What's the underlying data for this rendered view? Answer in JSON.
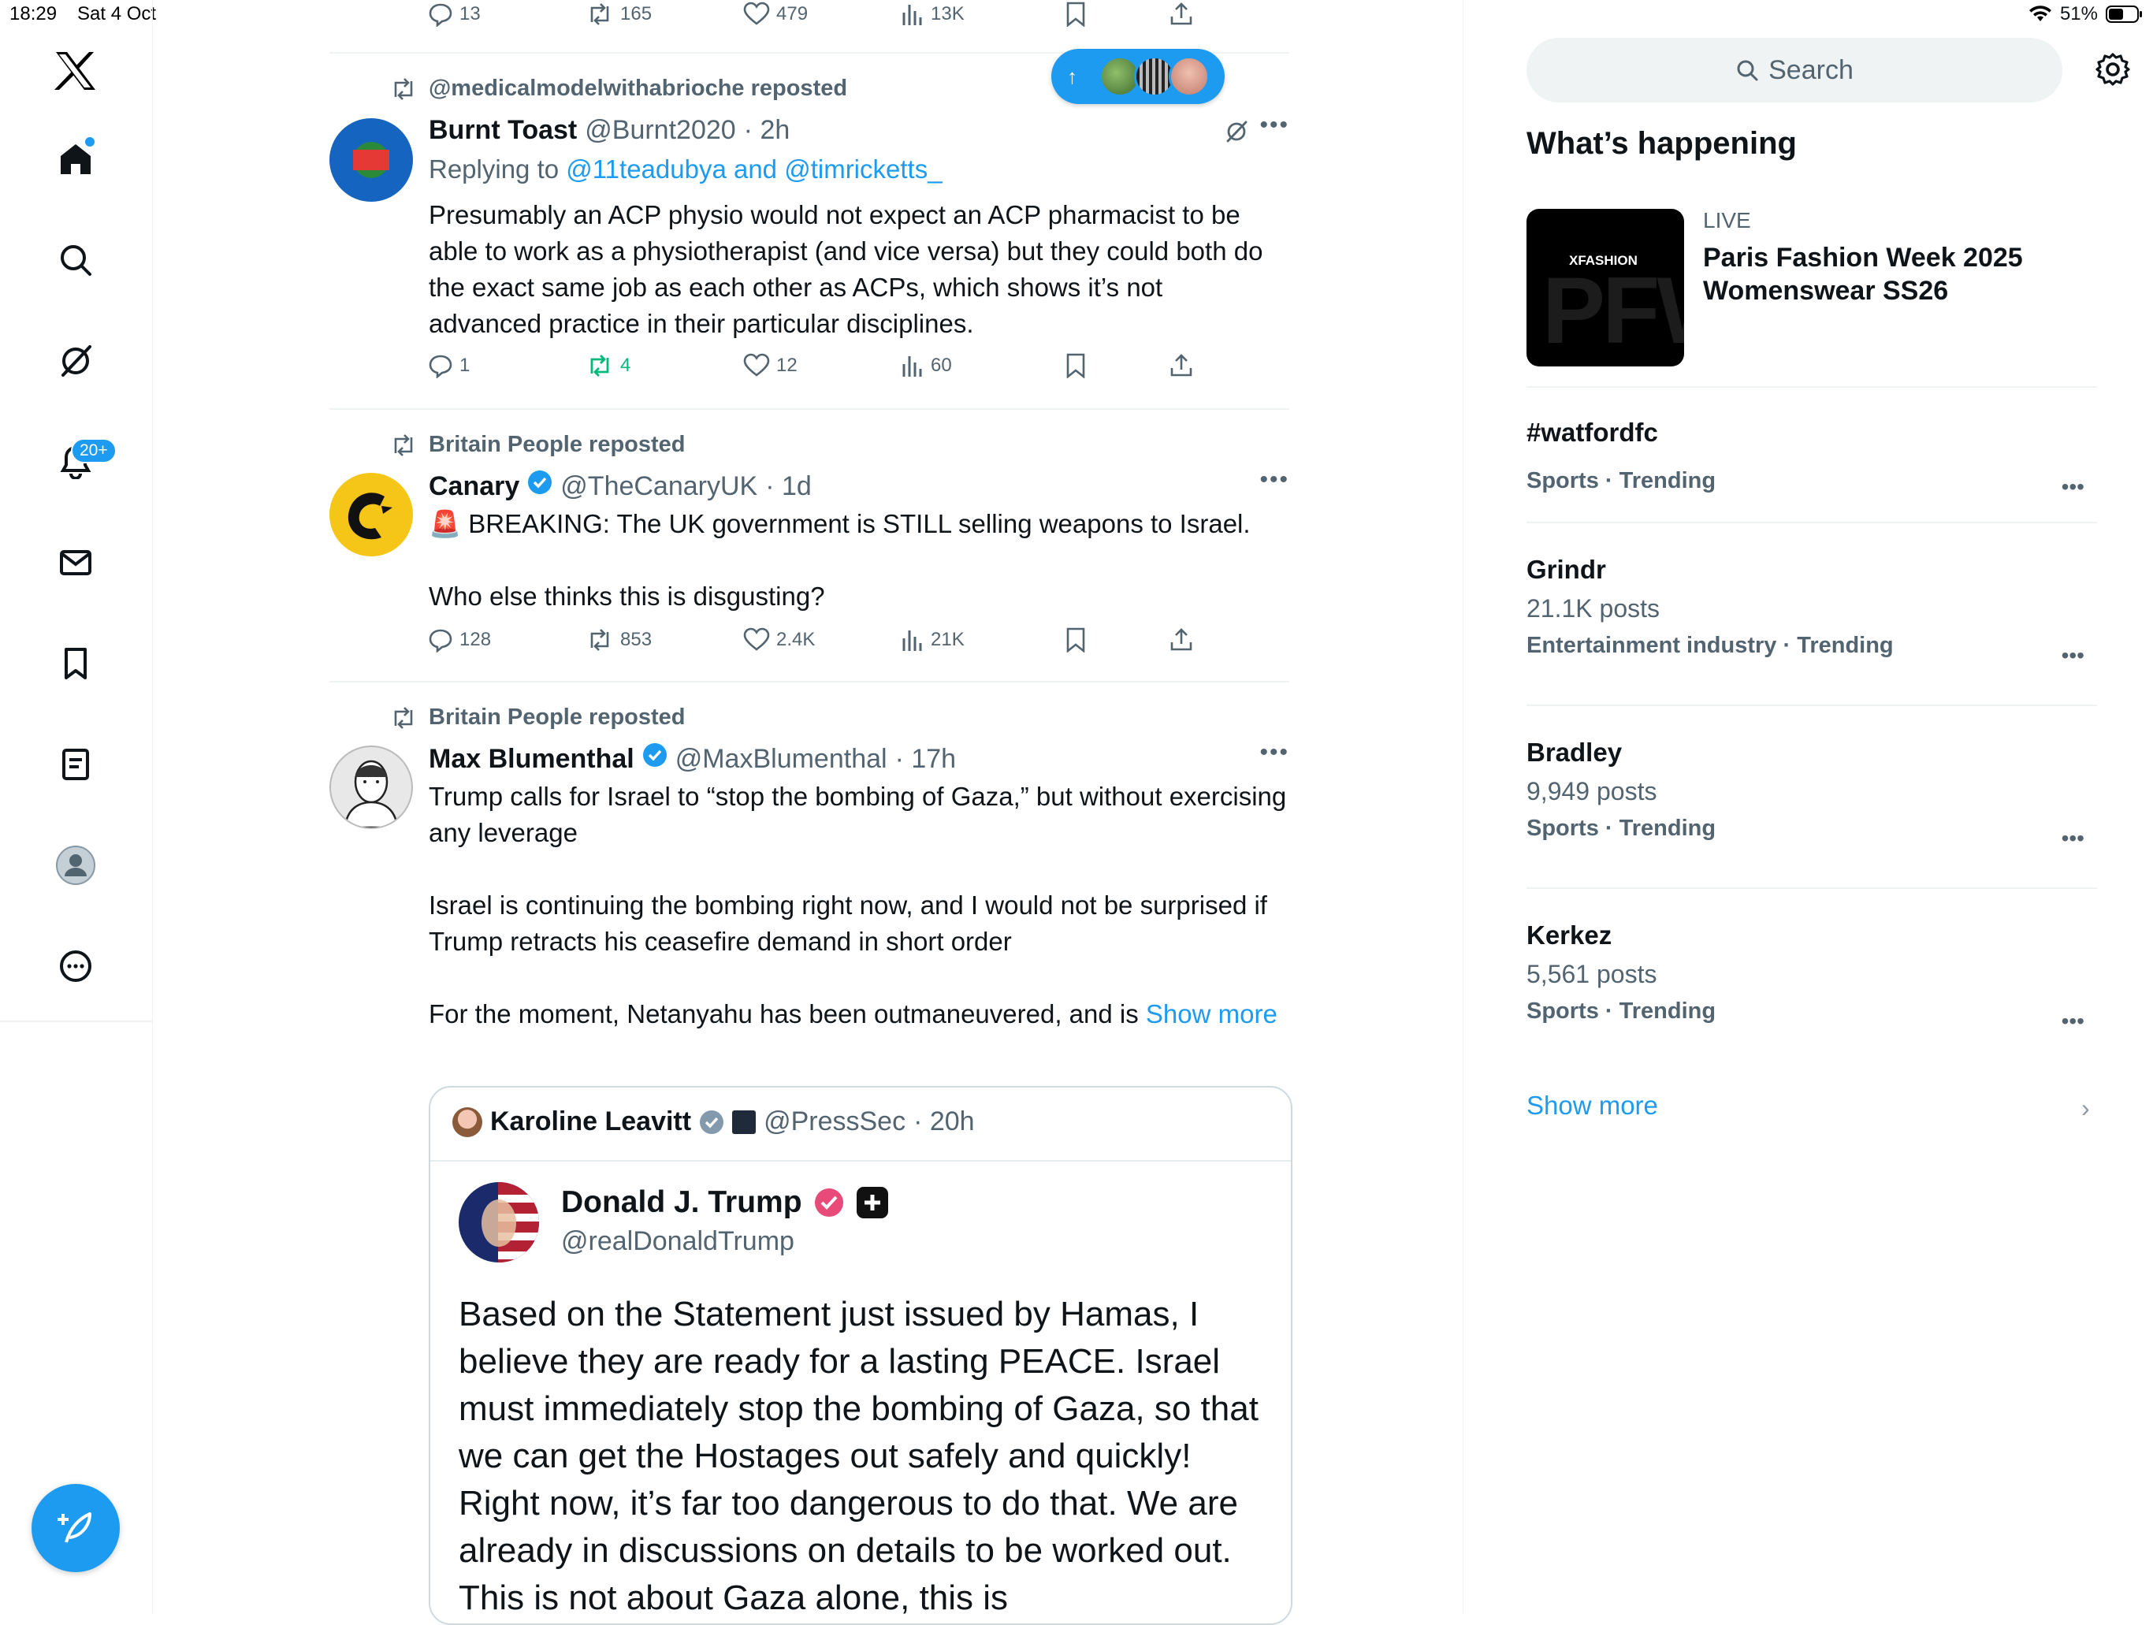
{
  "status_bar": {
    "time": "18:29",
    "date": "Sat 4 Oct",
    "battery": "51%"
  },
  "nav": {
    "notifications_badge": "20+"
  },
  "new_posts_pill": {
    "arrow": "↑"
  },
  "top_actions": {
    "replies": "13",
    "reposts": "165",
    "likes": "479",
    "views": "13K"
  },
  "posts": [
    {
      "repost_label": "@medicalmodelwithabrioche reposted",
      "name": "Burnt Toast",
      "handle": "@Burnt2020",
      "time": "· 2h",
      "replying_prefix": "Replying to ",
      "replying_to": "@11teadubya and @timricketts_",
      "text": "Presumably an ACP physio would not expect an ACP pharmacist to be able to work as a physiotherapist (and vice versa) but they could both do the exact same job as each other as ACPs, which shows it’s not advanced practice in their particular disciplines.",
      "replies": "1",
      "reposts": "4",
      "likes": "12",
      "views": "60"
    },
    {
      "repost_label": "Britain People reposted",
      "name": "Canary",
      "handle": "@TheCanaryUK",
      "time": "· 1d",
      "text_line1": "🚨 BREAKING: The UK government is STILL selling weapons to Israel.",
      "text_line2": "Who else thinks this is disgusting?",
      "replies": "128",
      "reposts": "853",
      "likes": "2.4K",
      "views": "21K"
    },
    {
      "repost_label": "Britain People reposted",
      "name": "Max Blumenthal",
      "handle": "@MaxBlumenthal",
      "time": "· 17h",
      "para1": "Trump calls for Israel to “stop the bombing of Gaza,” but without exercising any leverage",
      "para2": "Israel is continuing the bombing right now, and I would not be surprised if Trump retracts his ceasefire demand in short order",
      "para3": "For the moment, Netanyahu has been outmaneuvered, and is ",
      "show_more": "Show more",
      "quote": {
        "name": "Karoline Leavitt",
        "handle": "@PressSec",
        "time": "· 20h",
        "inner_name": "Donald J. Trump",
        "inner_handle": "@realDonaldTrump",
        "inner_text": "Based on the Statement just issued by Hamas, I believe they are ready for a lasting PEACE. Israel must immediately stop the bombing of Gaza, so that we can get the Hostages out safely and quickly! Right now, it’s far too dangerous to do that. We are already in discussions on details to be worked out. This is not about Gaza alone, this is"
      }
    }
  ],
  "sidebar": {
    "search_placeholder": "Search",
    "heading": "What’s happening",
    "featured": {
      "badge": "LIVE",
      "title": "Paris Fashion Week 2025 Womenswear SS26",
      "img_label": "XFASHION",
      "img_bg_text": "PFW"
    },
    "trends": [
      {
        "title": "#watfordfc",
        "posts": "",
        "category": "Sports · Trending"
      },
      {
        "title": "Grindr",
        "posts": "21.1K posts",
        "category": "Entertainment industry · Trending"
      },
      {
        "title": "Bradley",
        "posts": "9,949 posts",
        "category": "Sports · Trending"
      },
      {
        "title": "Kerkez",
        "posts": "5,561 posts",
        "category": "Sports · Trending"
      }
    ],
    "show_more": "Show more",
    "chevron": "›"
  },
  "colors": {
    "accent": "#1d9bf0",
    "text": "#0f1419",
    "secondary": "#536471",
    "repost_green": "#00ba7c",
    "divider": "#eff3f4"
  }
}
